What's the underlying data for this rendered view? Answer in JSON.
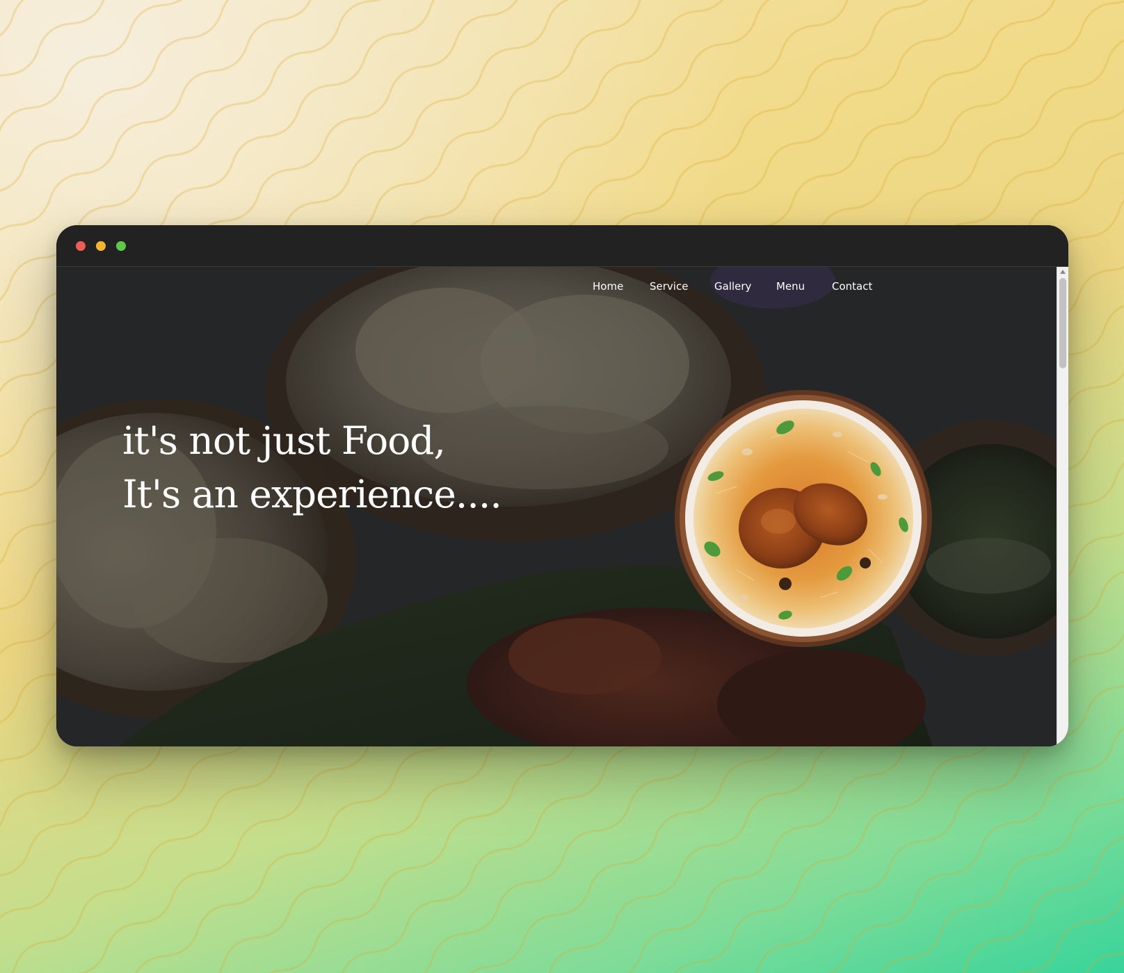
{
  "window": {
    "controls": [
      "close",
      "minimize",
      "maximize"
    ]
  },
  "nav": {
    "items": [
      {
        "label": "Home"
      },
      {
        "label": "Service"
      },
      {
        "label": "Gallery"
      },
      {
        "label": "Menu"
      },
      {
        "label": "Contact"
      }
    ]
  },
  "hero": {
    "line1": "it's not just Food,",
    "line2": "It's an experience...."
  },
  "colors": {
    "titlebar": "#222222",
    "close": "#ee5c56",
    "minimize": "#f2b531",
    "maximize": "#5ec848",
    "headline_text": "#ffffff",
    "nav_text": "#ffffff"
  }
}
